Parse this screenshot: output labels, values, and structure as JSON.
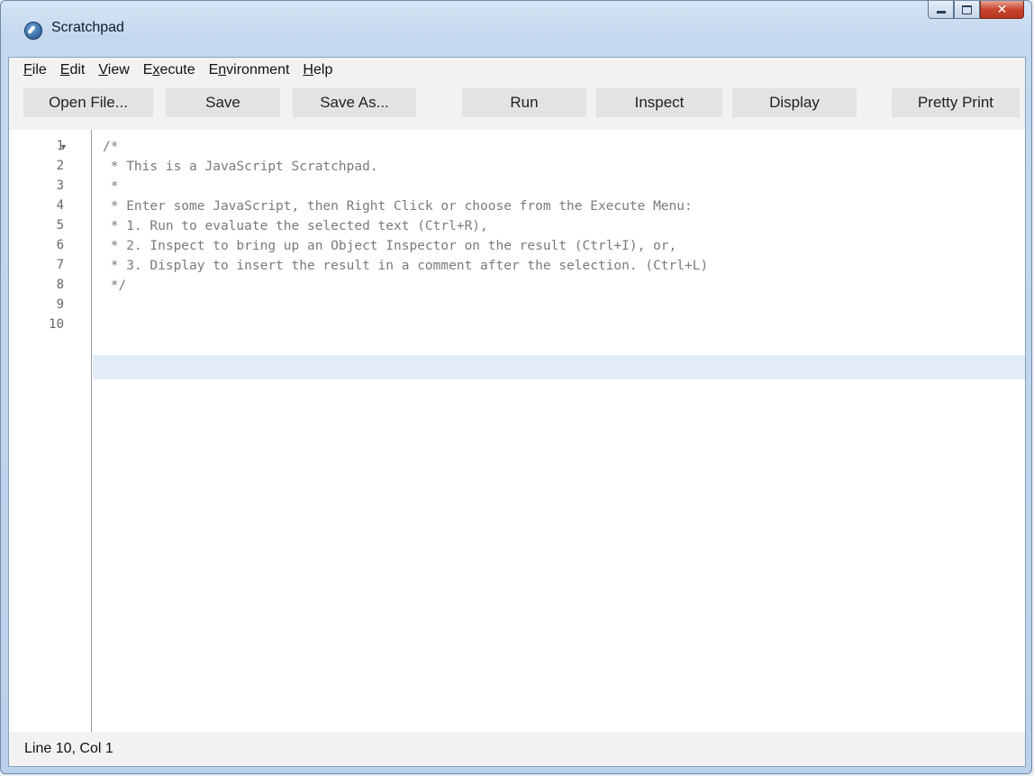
{
  "window": {
    "title": "Scratchpad"
  },
  "menu": [
    {
      "label": "File",
      "accel": "F",
      "rest": "ile"
    },
    {
      "label": "Edit",
      "accel": "E",
      "rest": "dit"
    },
    {
      "label": "View",
      "accel": "V",
      "rest": "iew"
    },
    {
      "label": "Execute",
      "pre": "E",
      "accel": "x",
      "rest": "ecute"
    },
    {
      "label": "Environment",
      "pre": "E",
      "accel": "n",
      "rest": "vironment"
    },
    {
      "label": "Help",
      "accel": "H",
      "rest": "elp"
    }
  ],
  "toolbar": {
    "open_file": "Open File...",
    "save": "Save",
    "save_as": "Save As...",
    "run": "Run",
    "inspect": "Inspect",
    "display": "Display",
    "pretty_print": "Pretty Print"
  },
  "editor": {
    "lines": [
      "/*",
      " * This is a JavaScript Scratchpad.",
      " *",
      " * Enter some JavaScript, then Right Click or choose from the Execute Menu:",
      " * 1. Run to evaluate the selected text (Ctrl+R),",
      " * 2. Inspect to bring up an Object Inspector on the result (Ctrl+I), or,",
      " * 3. Display to insert the result in a comment after the selection. (Ctrl+L)",
      " */",
      "",
      ""
    ],
    "line_numbers": [
      "1",
      "2",
      "3",
      "4",
      "5",
      "6",
      "7",
      "8",
      "9",
      "10"
    ],
    "fold_marker": "▾"
  },
  "status": {
    "position": "Line 10, Col 1"
  },
  "icons": {
    "app": "scratchpad-icon",
    "minimize": "minimize-icon",
    "maximize": "maximize-icon",
    "close": "close-icon"
  }
}
